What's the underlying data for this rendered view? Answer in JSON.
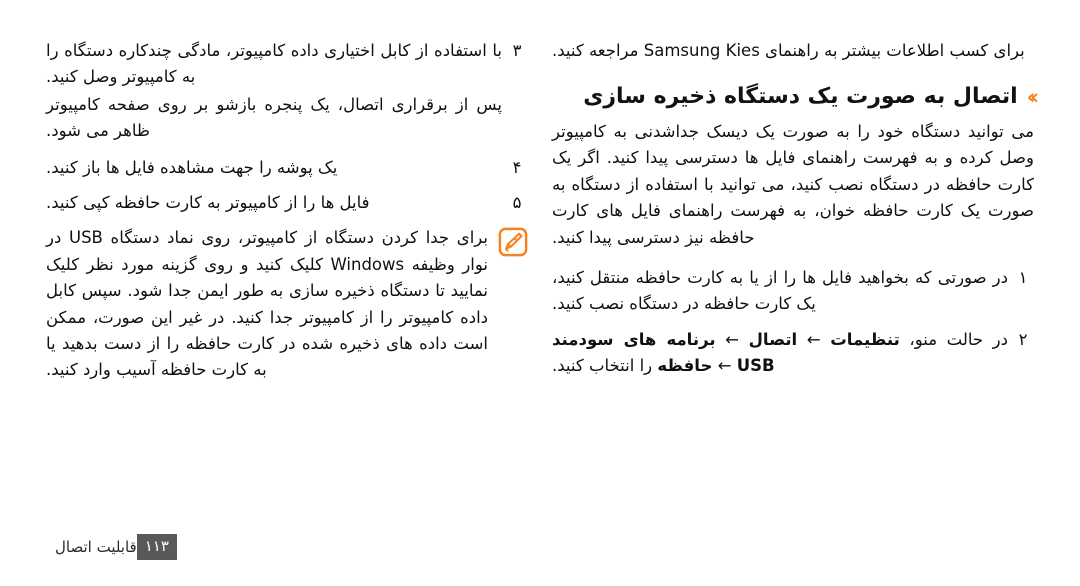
{
  "document": {
    "language": "fa",
    "direction": "rtl",
    "background_color": "#ffffff",
    "accent_color": "#F5821F",
    "text_color": "#111111"
  },
  "left_column": {
    "steps": [
      {
        "number": "۳",
        "text": "با استفاده از کابل اختیاری داده کامپیوتر، مادگی چندکاره دستگاه را به کامپیوتر وصل کنید.",
        "sub_text": "پس از برقراری اتصال، یک پنجره بازشو بر روی صفحه کامپیوتر ظاهر می شود."
      },
      {
        "number": "۴",
        "text": "یک پوشه را جهت مشاهده فایل ها باز کنید.",
        "sub_text": ""
      },
      {
        "number": "۵",
        "text": "فایل ها را از کامپیوتر به کارت حافظه کپی کنید.",
        "sub_text": ""
      }
    ],
    "note": {
      "icon": "note-pencil-icon",
      "icon_color": "#F5821F",
      "text_part_1": "برای جدا کردن دستگاه از کامپیوتر، روی نماد دستگاه ",
      "bold_1": "USB",
      "text_part_2": " در نوار وظیفه ",
      "bold_2": "Windows",
      "text_part_3": " کلیک کنید و روی گزینه مورد نظر کلیک نمایید تا دستگاه ذخیره سازی به طور ایمن جدا شود. سپس کابل داده کامپیوتر را از کامپیوتر جدا کنید. در غیر این صورت، ممکن است داده های ذخیره شده در کارت حافظه را از دست بدهید یا به کارت حافظه آسیب وارد کنید."
    }
  },
  "right_column": {
    "intro_paragraph": "برای کسب اطلاعات بیشتر به راهنمای Samsung Kies مراجعه کنید.",
    "heading": {
      "marker": "››",
      "title": "اتصال به صورت یک دستگاه ذخیره سازی"
    },
    "body_paragraph": "می توانید دستگاه خود را به صورت یک دیسک جداشدنی به کامپیوتر وصل کرده و به فهرست راهنمای فایل ها دسترسی پیدا کنید. اگر یک کارت حافظه در دستگاه نصب کنید، می توانید با استفاده از دستگاه به صورت یک کارت حافظه خوان، به فهرست راهنمای فایل های کارت حافظه نیز دسترسی پیدا کنید.",
    "steps": [
      {
        "number": "۱",
        "text": "در صورتی که بخواهید فایل ها را از یا به کارت حافظه منتقل کنید، یک کارت حافظه در دستگاه نصب کنید."
      },
      {
        "number": "۲",
        "text_prefix": "در حالت منو، ",
        "bold_1": "تنظیمات",
        "arrow_1": " ← ",
        "bold_2": "اتصال",
        "arrow_2": " ← ",
        "bold_3": "برنامه های سودمند USB",
        "arrow_3": " ← ",
        "bold_4": "حافظه",
        "text_suffix": " را انتخاب کنید."
      }
    ]
  },
  "footer": {
    "title": "قابلیت اتصال",
    "page_number": "۱۱۳",
    "page_box_color": "#58595B"
  }
}
